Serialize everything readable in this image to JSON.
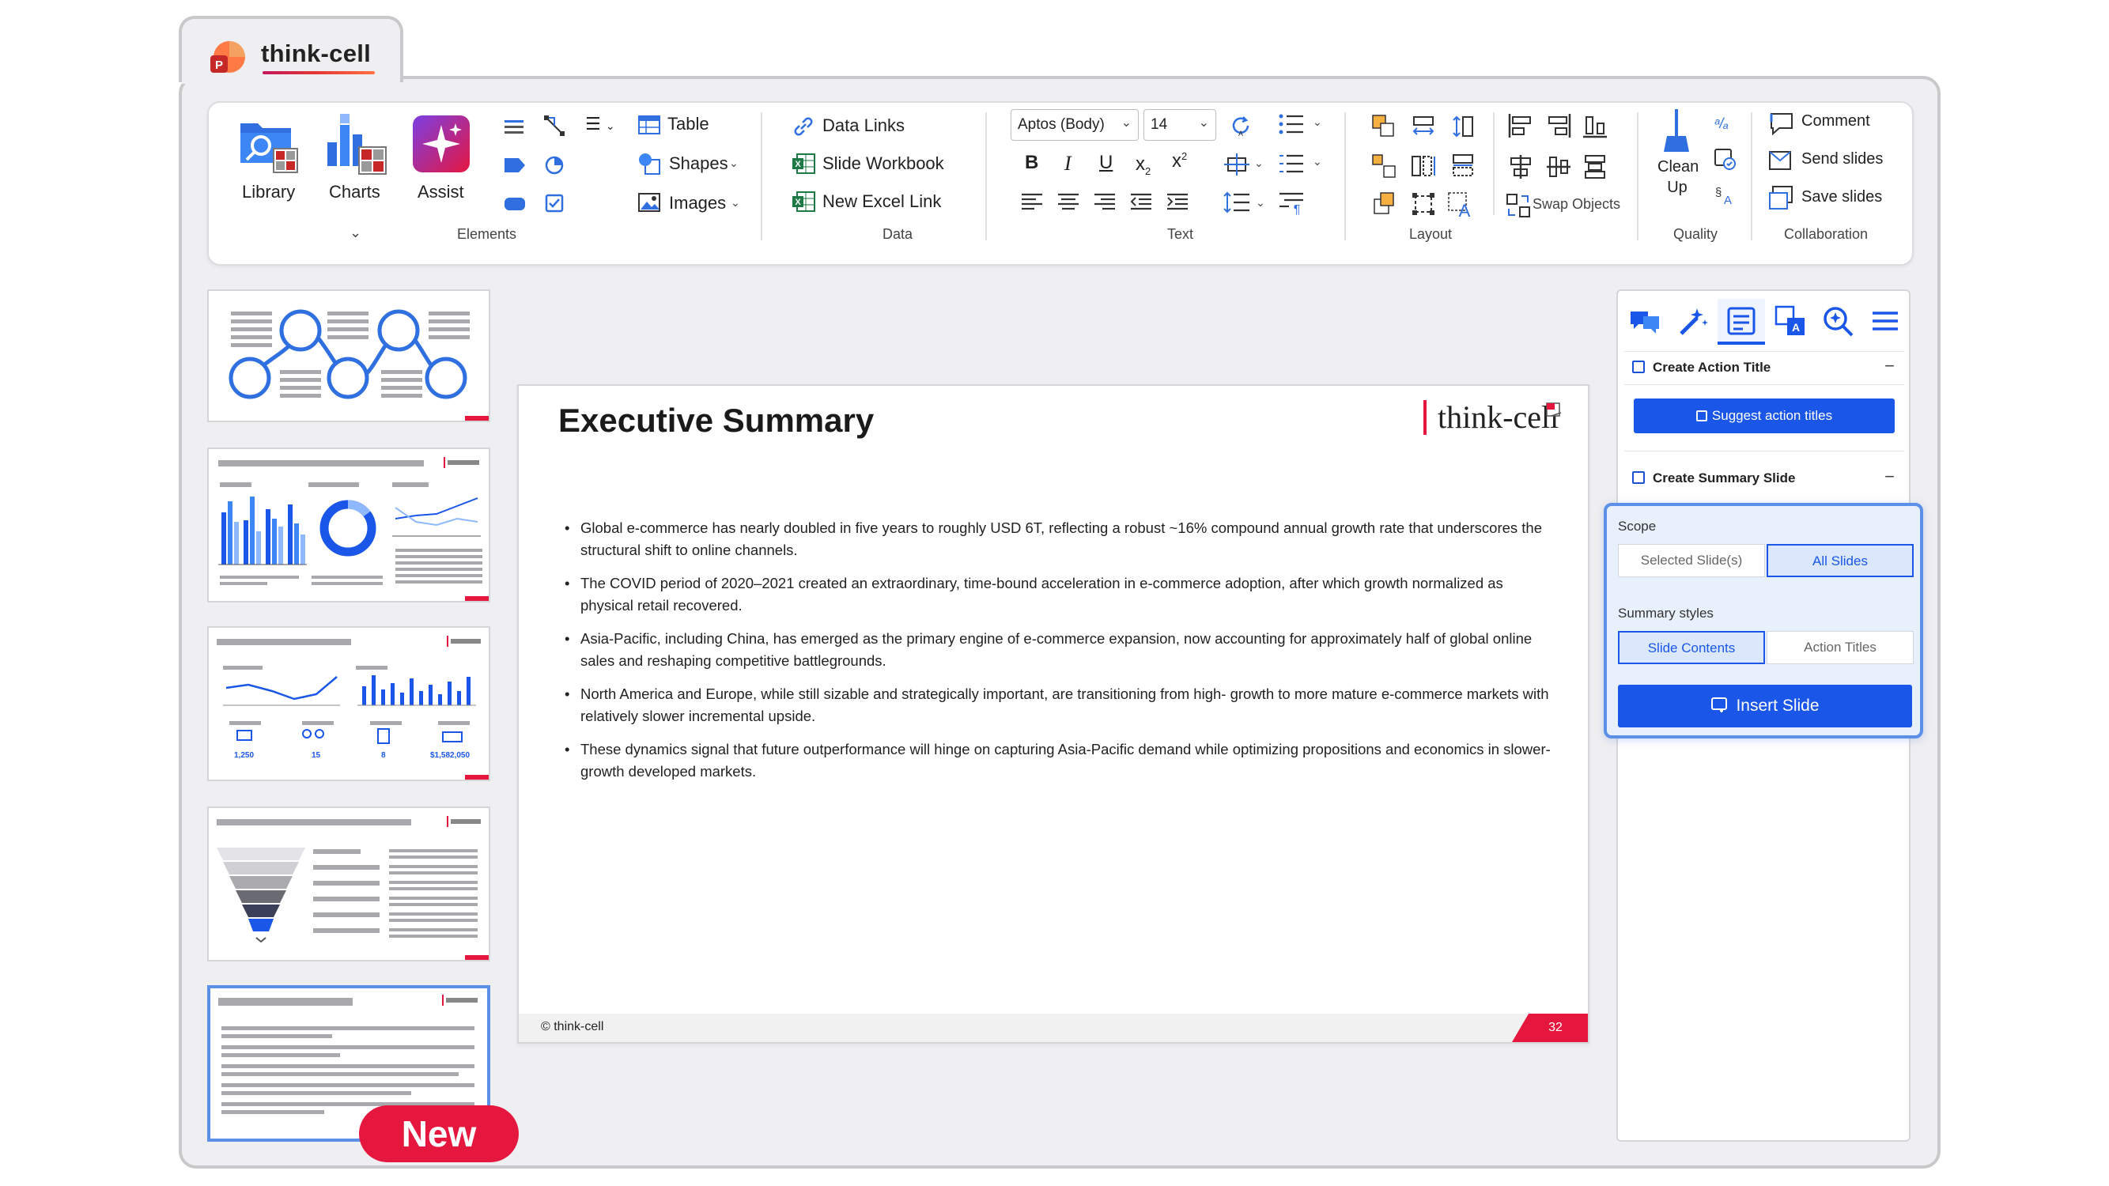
{
  "app": {
    "title": "think-cell"
  },
  "ribbon": {
    "library": "Library",
    "charts": "Charts",
    "assist": "Assist",
    "table": "Table",
    "shapes": "Shapes",
    "images": "Images",
    "elements_label": "Elements",
    "data_links": "Data Links",
    "slide_workbook": "Slide Workbook",
    "new_excel_link": "New Excel Link",
    "data_label": "Data",
    "font_name": "Aptos (Body)",
    "font_size": "14",
    "text_label": "Text",
    "swap_objects": "Swap Objects",
    "layout_label": "Layout",
    "clean_up": "Clean Up",
    "quality_label": "Quality",
    "comment": "Comment",
    "send_slides": "Send slides",
    "save_slides": "Save slides",
    "collaboration_label": "Collaboration",
    "bold": "B",
    "italic": "I",
    "underline": "U"
  },
  "thumbnails": {
    "badge": "New"
  },
  "slide": {
    "title": "Executive Summary",
    "logo_text": "think-cell",
    "bullets": [
      "Global e-commerce has nearly doubled in five years to roughly USD 6T, reflecting a robust ~16% compound annual growth rate that underscores the structural shift to online channels.",
      "The COVID period of 2020–2021 created an extraordinary, time-bound acceleration in e-commerce adoption, after which growth normalized as physical retail recovered.",
      "Asia-Pacific, including China, has emerged as the primary engine of e-commerce expansion, now accounting for approximately half of global online sales and reshaping competitive battlegrounds.",
      "North America and Europe, while still sizable and strategically important, are transitioning from high- growth to more mature e-commerce markets with relatively slower incremental upside.",
      "These dynamics signal that future outperformance will hinge on capturing Asia-Pacific demand while optimizing propositions and economics in slower-growth developed markets."
    ],
    "footer": "© think-cell",
    "page_number": "32"
  },
  "panel": {
    "create_action_title": "Create Action Title",
    "suggest_action_titles": "Suggest action titles",
    "create_summary_slide": "Create Summary Slide",
    "scope_label": "Scope",
    "scope_options": [
      "Selected Slide(s)",
      "All Slides"
    ],
    "summary_styles_label": "Summary styles",
    "style_options": [
      "Slide Contents",
      "Action Titles"
    ],
    "insert_slide": "Insert Slide",
    "collapse_symbol": "−"
  },
  "thumb_text": {
    "t3_v1": "1,250",
    "t3_v2": "15",
    "t3_v3": "8",
    "t3_v4": "$1,582,050"
  },
  "colors": {
    "accent_blue": "#1a56e8",
    "think_cell_red": "#e5173f"
  }
}
